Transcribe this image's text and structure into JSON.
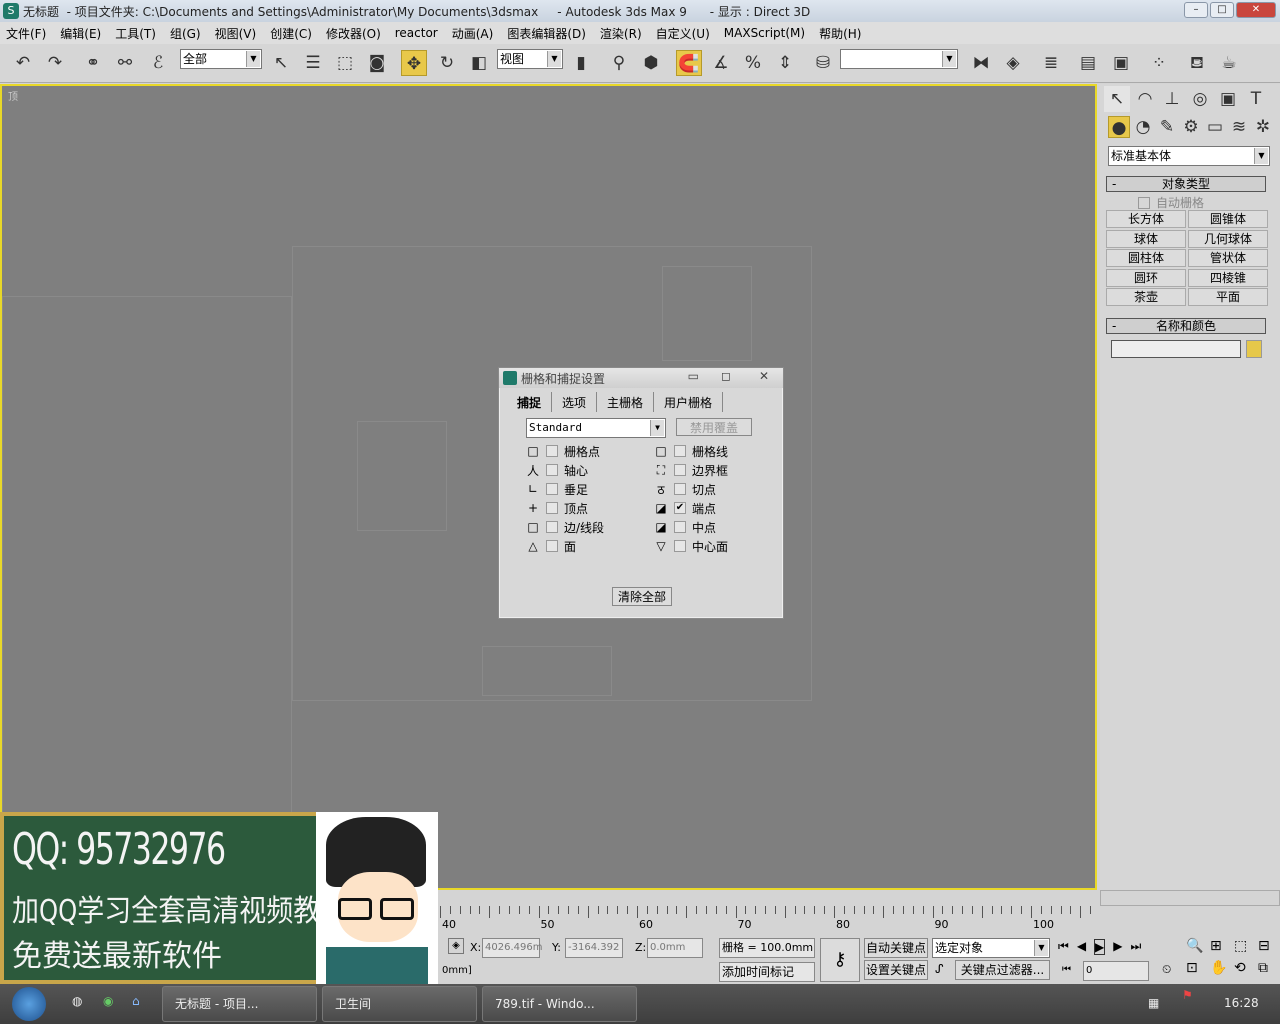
{
  "window": {
    "title_doc": "无标题",
    "title_rest": "  - 项目文件夹: C:\\Documents and Settings\\Administrator\\My Documents\\3dsmax     - Autodesk 3ds Max 9      - 显示 : Direct 3D",
    "minimize": "–",
    "maximize": "□",
    "close": "✕"
  },
  "menu": [
    "文件(F)",
    "编辑(E)",
    "工具(T)",
    "组(G)",
    "视图(V)",
    "创建(C)",
    "修改器(O)",
    "reactor",
    "动画(A)",
    "图表编辑器(D)",
    "渲染(R)",
    "自定义(U)",
    "MAXScript(M)",
    "帮助(H)"
  ],
  "toolbar": {
    "selection_filter": "全部",
    "ref_coord": "视图",
    "named_selection": "",
    "accent": "#e8c84a"
  },
  "viewport": {
    "label": "顶",
    "border_color": "#e8d828"
  },
  "command_panel": {
    "category": "标准基本体",
    "object_type_title": "对象类型",
    "autogrid": "自动栅格",
    "buttons": [
      "长方体",
      "圆锥体",
      "球体",
      "几何球体",
      "圆柱体",
      "管状体",
      "圆环",
      "四棱锥",
      "茶壶",
      "平面"
    ],
    "name_color_title": "名称和颜色",
    "name_value": "",
    "color": "#e6c84a",
    "collapse": "-"
  },
  "dialog": {
    "title": "栅格和捕捉设置",
    "tabs": [
      "捕捉",
      "选项",
      "主栅格",
      "用户栅格"
    ],
    "preset": "Standard",
    "override": "禁用覆盖",
    "left": [
      {
        "sym": "□",
        "label": "栅格点",
        "checked": false
      },
      {
        "sym": "人",
        "label": "轴心",
        "checked": false
      },
      {
        "sym": "∟",
        "label": "垂足",
        "checked": false
      },
      {
        "sym": "+",
        "label": "顶点",
        "checked": false
      },
      {
        "sym": "□",
        "label": "边/线段",
        "checked": false
      },
      {
        "sym": "△",
        "label": "面",
        "checked": false
      }
    ],
    "right": [
      {
        "sym": "□",
        "label": "栅格线",
        "checked": false
      },
      {
        "sym": "⛶",
        "label": "边界框",
        "checked": false
      },
      {
        "sym": "ठ",
        "label": "切点",
        "checked": false
      },
      {
        "sym": "◪",
        "label": "端点",
        "checked": true
      },
      {
        "sym": "◪",
        "label": "中点",
        "checked": false
      },
      {
        "sym": "▽",
        "label": "中心面",
        "checked": false
      }
    ],
    "clear_all": "清除全部"
  },
  "timeline": {
    "ticks": [
      "40",
      "50",
      "60",
      "70",
      "80",
      "90",
      "100"
    ]
  },
  "status": {
    "x_label": "X:",
    "x": "4026.496m",
    "y_label": "Y:",
    "y": "-3164.392",
    "z_label": "Z:",
    "z": "0.0mm",
    "grid": "栅格 = 100.0mm",
    "prompt": "0mm]",
    "add_time_tag": "添加时间标记",
    "auto_key": "自动关键点",
    "set_key": "设置关键点",
    "selected": "选定对象",
    "key_filters": "关键点过滤器...",
    "frame": "0"
  },
  "banner": {
    "qq": "QQ: 95732976",
    "line1": "加QQ学习全套高清视频教程",
    "line2": "免费送最新软件"
  },
  "taskbar": {
    "tasks": [
      "无标题      - 项目...",
      "卫生间",
      "789.tif - Windo..."
    ],
    "clock": "16:28"
  }
}
